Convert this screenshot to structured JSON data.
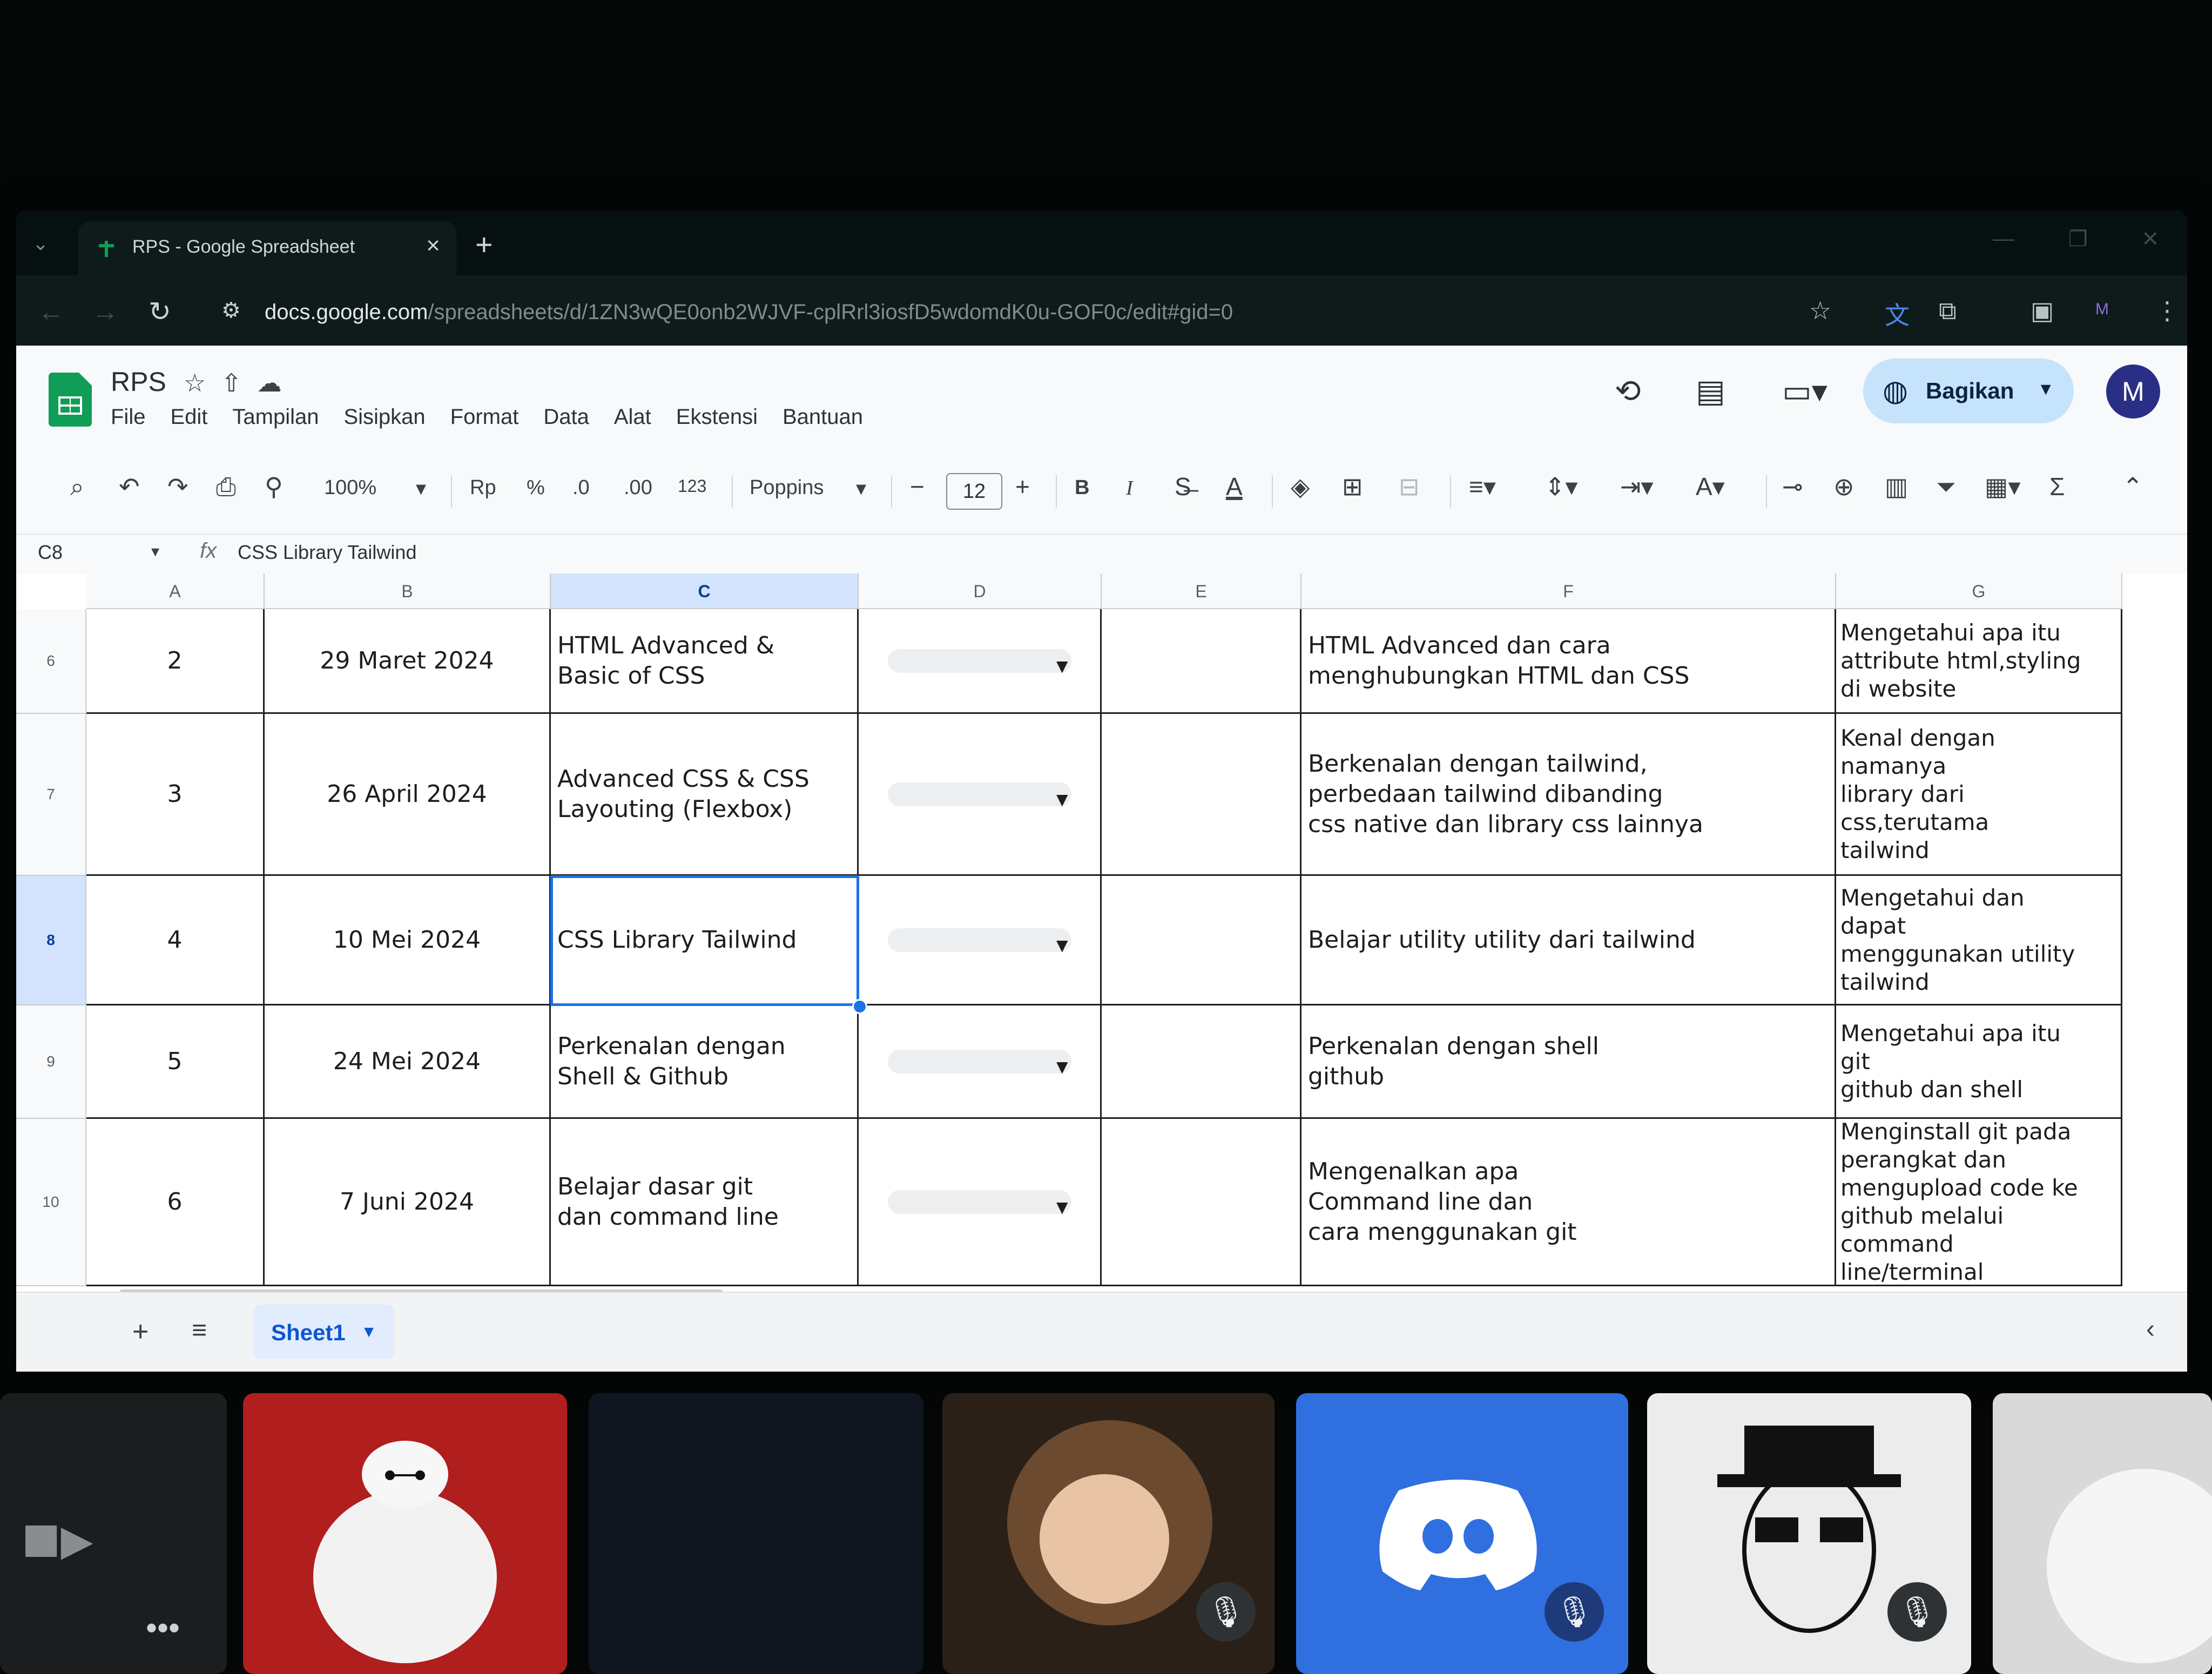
{
  "browser": {
    "tab_title": "RPS - Google Spreadsheet",
    "tab_close": "×",
    "new_tab": "+",
    "url_host": "docs.google.com",
    "url_path": "/spreadsheets/d/1ZN3wQE0onb2WJVF-cplRrl3iosfD5wdomdK0u-GOF0c/edit#gid=0",
    "profile_letter": "M"
  },
  "app": {
    "doc_title": "RPS",
    "menu": [
      "File",
      "Edit",
      "Tampilan",
      "Sisipkan",
      "Format",
      "Data",
      "Alat",
      "Ekstensi",
      "Bantuan"
    ],
    "share_label": "Bagikan",
    "avatar_letter": "M"
  },
  "toolbar": {
    "zoom": "100%",
    "currency": "Rp",
    "percent": "%",
    "decimal_decrease": ".0",
    "decimal_increase": ".00",
    "number_format": "123",
    "font": "Poppins",
    "font_size": "12",
    "bold": "B",
    "italic": "I"
  },
  "formula_bar": {
    "cell_ref": "C8",
    "fx": "fx",
    "content": "CSS Library Tailwind"
  },
  "grid": {
    "columns": [
      "A",
      "B",
      "C",
      "D",
      "E",
      "F",
      "G"
    ],
    "selected_column": "C",
    "selected_row": "8",
    "rows": [
      {
        "num": "6",
        "a": "2",
        "b": "29 Maret 2024",
        "c": "HTML Advanced &\nBasic of CSS",
        "f": "HTML Advanced dan cara\nmenghubungkan HTML dan CSS",
        "g": "Mengetahui apa itu\nattribute html,styling\ndi website"
      },
      {
        "num": "7",
        "a": "3",
        "b": "26 April 2024",
        "c": "Advanced CSS & CSS\nLayouting (Flexbox)",
        "f": "Berkenalan dengan tailwind,\nperbedaan tailwind dibanding\ncss native dan library css lainnya",
        "g": "Kenal dengan\nnamanya\nlibrary dari\ncss,terutama\ntailwind"
      },
      {
        "num": "8",
        "a": "4",
        "b": "10 Mei 2024",
        "c": "CSS Library Tailwind",
        "f": "Belajar utility utility dari tailwind",
        "g": "Mengetahui dan\ndapat\nmenggunakan utility\ntailwind"
      },
      {
        "num": "9",
        "a": "5",
        "b": "24 Mei 2024",
        "c": "Perkenalan dengan\nShell & Github",
        "f": "Perkenalan dengan shell\ngithub",
        "g": "Mengetahui apa itu\ngit\ngithub dan shell"
      },
      {
        "num": "10",
        "a": "6",
        "b": "7 Juni 2024",
        "c": "Belajar dasar git\ndan command line",
        "f": "Mengenalkan apa\nCommand line dan\ncara menggunakan git",
        "g": "Menginstall git pada\nperangkat dan\nmengupload code ke\ngithub melalui\ncommand\nline/terminal"
      }
    ]
  },
  "sheetbar": {
    "add": "+",
    "sheet_name": "Sheet1"
  },
  "colors": {
    "accent": "#1a73e8",
    "share_bg": "#c5e3fb",
    "selected_header": "#d3e3fd",
    "sheets_green": "#0f9d58",
    "discord_blue": "#2f6fe0"
  },
  "icons": [
    "search-icon",
    "undo-icon",
    "redo-icon",
    "print-icon",
    "paint-format-icon",
    "history-icon",
    "comment-icon",
    "meet-icon",
    "globe-icon",
    "star-icon",
    "move-icon",
    "cloud-icon",
    "link-icon",
    "filter-icon",
    "function-icon",
    "mic-off-icon",
    "discord-icon"
  ]
}
